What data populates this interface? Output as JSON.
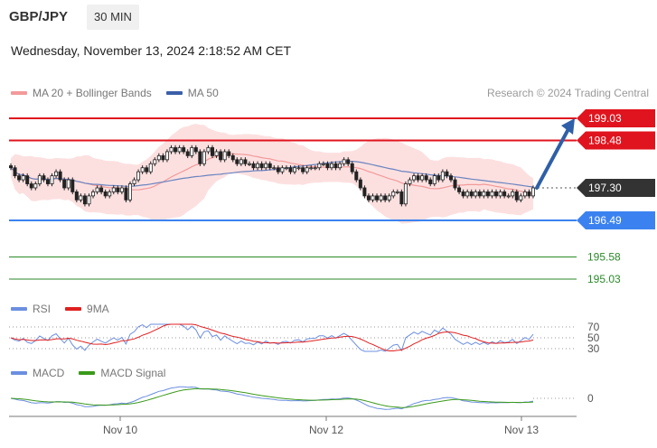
{
  "header": {
    "pair": "GBP/JPY",
    "timeframe": "30 MIN",
    "datetime": "Wednesday, November 13, 2024 2:18:52 AM CET",
    "credit": "Research © 2024 Trading Central"
  },
  "legends": {
    "main": [
      {
        "label": "MA 20 + Bollinger Bands",
        "color": "#f29a9a"
      },
      {
        "label": "MA 50",
        "color": "#3b5fa8"
      }
    ],
    "rsi": [
      {
        "label": "RSI",
        "color": "#6b8fe0"
      },
      {
        "label": "9MA",
        "color": "#e02020"
      }
    ],
    "macd": [
      {
        "label": "MACD",
        "color": "#6b8fe0"
      },
      {
        "label": "MACD Signal",
        "color": "#3a9a1a"
      }
    ]
  },
  "chart_data": {
    "type": "candlestick",
    "x_ticks": [
      "Nov 10",
      "Nov 12",
      "Nov 13"
    ],
    "ylim": [
      194.9,
      199.2
    ],
    "levels": [
      {
        "value": 199.03,
        "label": "199.03",
        "kind": "resistance",
        "color": "#e0141e"
      },
      {
        "value": 198.48,
        "label": "198.48",
        "kind": "resistance",
        "color": "#e0141e"
      },
      {
        "value": 197.3,
        "label": "197.30",
        "kind": "current",
        "color": "#333333"
      },
      {
        "value": 196.49,
        "label": "196.49",
        "kind": "pivot",
        "color": "#3b82f0"
      },
      {
        "value": 195.58,
        "label": "195.58",
        "kind": "support",
        "color": "#2a8a2a"
      },
      {
        "value": 195.03,
        "label": "195.03",
        "kind": "support",
        "color": "#2a8a2a"
      }
    ],
    "close": [
      197.8,
      197.6,
      197.5,
      197.6,
      197.4,
      197.3,
      197.4,
      197.6,
      197.5,
      197.4,
      197.6,
      197.7,
      197.5,
      197.3,
      197.5,
      197.2,
      197.0,
      197.1,
      196.9,
      197.1,
      197.2,
      197.3,
      197.2,
      197.1,
      197.2,
      197.3,
      197.2,
      197.3,
      197.0,
      197.4,
      197.5,
      197.7,
      197.8,
      197.7,
      197.9,
      198.0,
      198.1,
      198.0,
      198.2,
      198.3,
      198.2,
      198.3,
      198.2,
      198.1,
      198.3,
      198.2,
      197.9,
      198.2,
      198.3,
      198.1,
      198.2,
      198.0,
      198.2,
      198.1,
      198.0,
      197.9,
      198.0,
      197.9,
      197.9,
      197.8,
      197.9,
      197.8,
      197.9,
      197.8,
      197.8,
      197.7,
      197.8,
      197.8,
      197.7,
      197.8,
      197.8,
      197.7,
      197.8,
      197.8,
      197.8,
      197.9,
      197.9,
      197.8,
      197.9,
      197.8,
      197.9,
      198.0,
      197.9,
      197.7,
      197.5,
      197.3,
      197.1,
      197.0,
      197.1,
      197.0,
      197.1,
      197.0,
      197.1,
      197.2,
      197.2,
      196.9,
      197.4,
      197.5,
      197.6,
      197.5,
      197.6,
      197.5,
      197.4,
      197.6,
      197.5,
      197.7,
      197.6,
      197.5,
      197.3,
      197.2,
      197.1,
      197.2,
      197.1,
      197.2,
      197.1,
      197.2,
      197.1,
      197.2,
      197.1,
      197.2,
      197.1,
      197.1,
      197.2,
      197.0,
      197.1,
      197.2,
      197.1,
      197.3
    ],
    "forecast_target": 199.03,
    "rsi": {
      "levels": [
        70,
        50,
        30
      ]
    },
    "macd": {
      "levels": [
        0
      ]
    }
  }
}
